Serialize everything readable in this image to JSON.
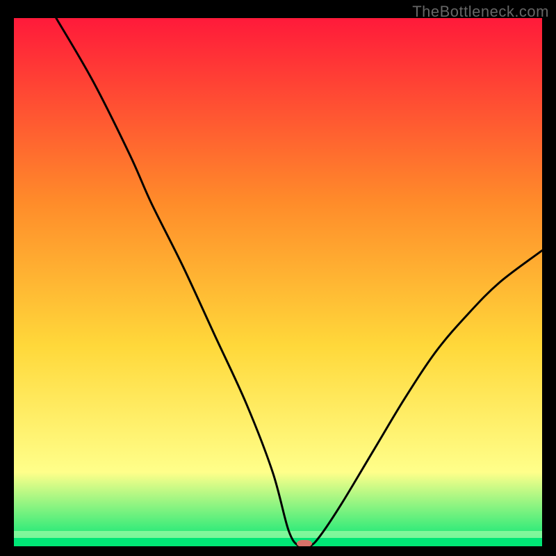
{
  "watermark": "TheBottleneck.com",
  "chart_data": {
    "type": "line",
    "title": "",
    "xlabel": "",
    "ylabel": "",
    "ylim": [
      0,
      100
    ],
    "xlim": [
      0,
      100
    ],
    "background_gradient": {
      "top": "#ff1a3a",
      "mid1": "#ff8c2a",
      "mid2": "#ffd83a",
      "soft": "#ffff8a",
      "bottom": "#00e676"
    },
    "marker": {
      "x": 55,
      "y": 0,
      "color": "#d9716a",
      "rx": 8,
      "width": 22,
      "height": 10
    },
    "series": [
      {
        "name": "curve",
        "points": [
          {
            "x": 8,
            "y": 100
          },
          {
            "x": 15,
            "y": 88
          },
          {
            "x": 22,
            "y": 74
          },
          {
            "x": 26,
            "y": 65
          },
          {
            "x": 32,
            "y": 53
          },
          {
            "x": 38,
            "y": 40
          },
          {
            "x": 44,
            "y": 27
          },
          {
            "x": 49,
            "y": 14
          },
          {
            "x": 52,
            "y": 3
          },
          {
            "x": 54,
            "y": 0
          },
          {
            "x": 56,
            "y": 0
          },
          {
            "x": 58,
            "y": 2
          },
          {
            "x": 62,
            "y": 8
          },
          {
            "x": 68,
            "y": 18
          },
          {
            "x": 74,
            "y": 28
          },
          {
            "x": 80,
            "y": 37
          },
          {
            "x": 86,
            "y": 44
          },
          {
            "x": 92,
            "y": 50
          },
          {
            "x": 100,
            "y": 56
          }
        ]
      }
    ]
  }
}
